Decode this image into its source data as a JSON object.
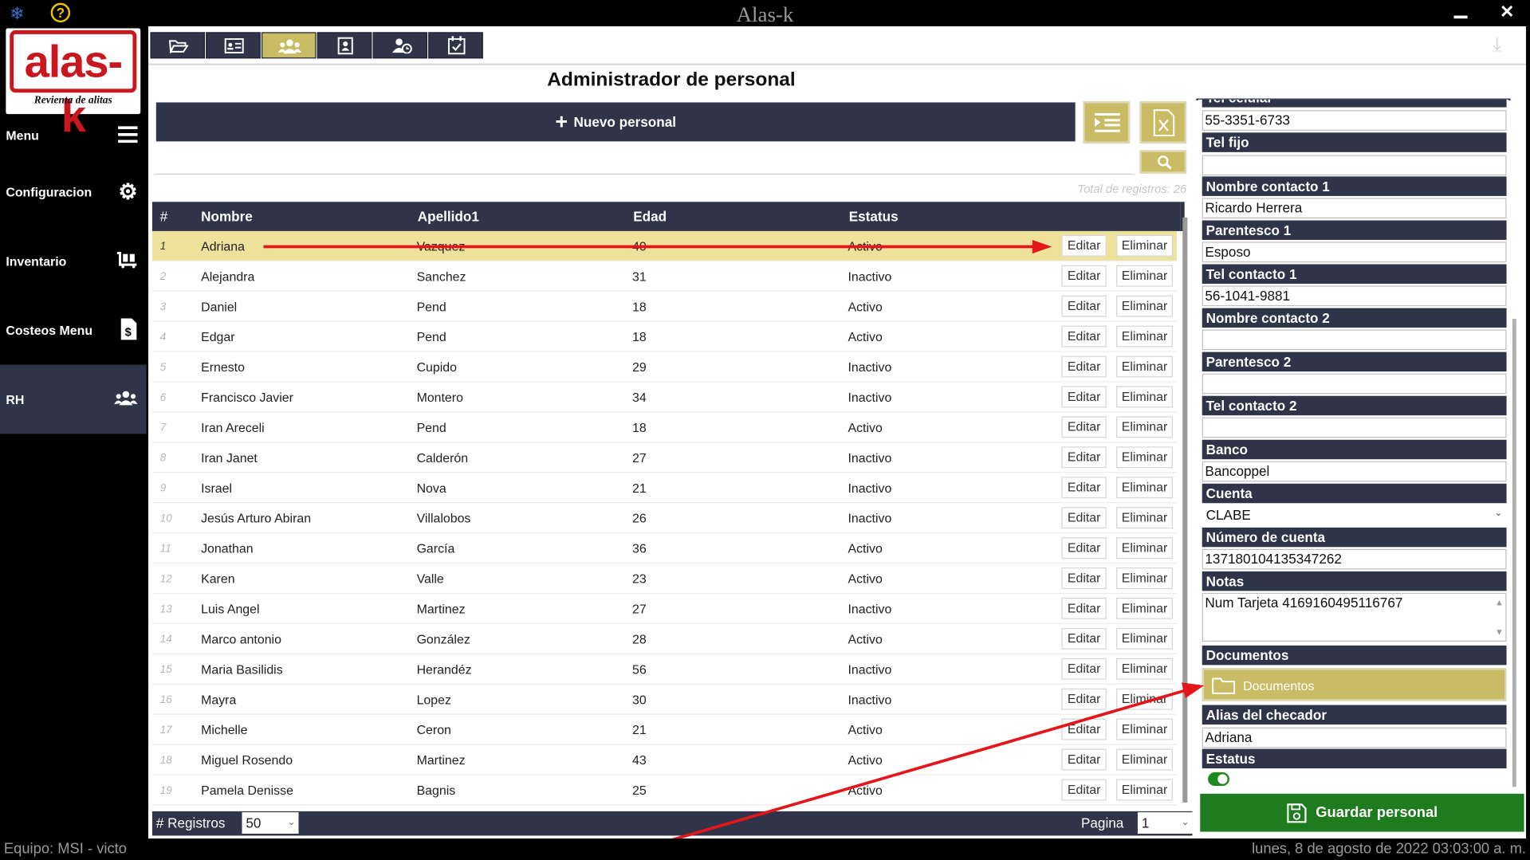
{
  "app": {
    "title": "Alas-k"
  },
  "sidebar": {
    "logo_text": "alas-k",
    "logo_tagline": "Revienta de alitas",
    "items": [
      {
        "label": "Menu",
        "icon": "hamburger-icon"
      },
      {
        "label": "Configuracion",
        "icon": "gear-icon"
      },
      {
        "label": "Inventario",
        "icon": "inventory-cart-icon"
      },
      {
        "label": "Costeos Menu",
        "icon": "invoice-dollar-icon"
      },
      {
        "label": "RH",
        "icon": "users-icon"
      }
    ]
  },
  "toolbar": {
    "tabs": [
      {
        "icon": "folder-open-icon"
      },
      {
        "icon": "id-card-icon"
      },
      {
        "icon": "users-icon"
      },
      {
        "icon": "contact-book-icon"
      },
      {
        "icon": "user-clock-icon"
      },
      {
        "icon": "calendar-check-icon"
      }
    ]
  },
  "main": {
    "title": "Administrador de personal",
    "new_button": "Nuevo personal",
    "search_placeholder": "",
    "total_label": "Total de registros:",
    "total_count": "26"
  },
  "table": {
    "headers": [
      "#",
      "Nombre",
      "Apellido1",
      "Edad",
      "Estatus"
    ],
    "edit_label": "Editar",
    "delete_label": "Eliminar",
    "rows": [
      {
        "n": "1",
        "nombre": "Adriana",
        "apellido": "Vazquez",
        "edad": "40",
        "estatus": "Activo"
      },
      {
        "n": "2",
        "nombre": "Alejandra",
        "apellido": "Sanchez",
        "edad": "31",
        "estatus": "Inactivo"
      },
      {
        "n": "3",
        "nombre": "Daniel",
        "apellido": "Pend",
        "edad": "18",
        "estatus": "Activo"
      },
      {
        "n": "4",
        "nombre": "Edgar",
        "apellido": "Pend",
        "edad": "18",
        "estatus": "Activo"
      },
      {
        "n": "5",
        "nombre": "Ernesto",
        "apellido": "Cupido",
        "edad": "29",
        "estatus": "Inactivo"
      },
      {
        "n": "6",
        "nombre": "Francisco Javier",
        "apellido": "Montero",
        "edad": "34",
        "estatus": "Inactivo"
      },
      {
        "n": "7",
        "nombre": "Iran Areceli",
        "apellido": "Pend",
        "edad": "18",
        "estatus": "Activo"
      },
      {
        "n": "8",
        "nombre": "Iran Janet",
        "apellido": "Calderón",
        "edad": "27",
        "estatus": "Inactivo"
      },
      {
        "n": "9",
        "nombre": "Israel",
        "apellido": "Nova",
        "edad": "21",
        "estatus": "Inactivo"
      },
      {
        "n": "10",
        "nombre": "Jesús Arturo Abiran",
        "apellido": "Villalobos",
        "edad": "26",
        "estatus": "Inactivo"
      },
      {
        "n": "11",
        "nombre": "Jonathan",
        "apellido": "García",
        "edad": "36",
        "estatus": "Activo"
      },
      {
        "n": "12",
        "nombre": "Karen",
        "apellido": "Valle",
        "edad": "23",
        "estatus": "Activo"
      },
      {
        "n": "13",
        "nombre": "Luis Angel",
        "apellido": "Martinez",
        "edad": "27",
        "estatus": "Inactivo"
      },
      {
        "n": "14",
        "nombre": "Marco antonio",
        "apellido": "González",
        "edad": "28",
        "estatus": "Activo"
      },
      {
        "n": "15",
        "nombre": "Maria Basilidis",
        "apellido": "Herandéz",
        "edad": "56",
        "estatus": "Inactivo"
      },
      {
        "n": "16",
        "nombre": "Mayra",
        "apellido": "Lopez",
        "edad": "30",
        "estatus": "Inactivo"
      },
      {
        "n": "17",
        "nombre": "Michelle",
        "apellido": "Ceron",
        "edad": "21",
        "estatus": "Activo"
      },
      {
        "n": "18",
        "nombre": "Miguel Rosendo",
        "apellido": "Martinez",
        "edad": "43",
        "estatus": "Activo"
      },
      {
        "n": "19",
        "nombre": "Pamela Denisse",
        "apellido": "Bagnis",
        "edad": "25",
        "estatus": "Activo"
      }
    ]
  },
  "footer": {
    "registros_label": "# Registros",
    "registros_value": "50",
    "pagina_label": "Pagina",
    "pagina_value": "1"
  },
  "form": {
    "tel_celular_label": "Tel celular",
    "tel_celular": "55-3351-6733",
    "tel_fijo_label": "Tel fijo",
    "tel_fijo": "",
    "contacto1_label": "Nombre contacto 1",
    "contacto1": "Ricardo Herrera",
    "parentesco1_label": "Parentesco 1",
    "parentesco1": "Esposo",
    "telcontacto1_label": "Tel contacto 1",
    "telcontacto1": "56-1041-9881",
    "contacto2_label": "Nombre contacto 2",
    "contacto2": "",
    "parentesco2_label": "Parentesco 2",
    "parentesco2": "",
    "telcontacto2_label": "Tel contacto 2",
    "telcontacto2": "",
    "banco_label": "Banco",
    "banco": "Bancoppel",
    "cuenta_label": "Cuenta",
    "cuenta": "CLABE",
    "numcuenta_label": "Número de cuenta",
    "numcuenta": "137180104135347262",
    "notas_label": "Notas",
    "notas": "Num Tarjeta 4169160495116767",
    "documentos_label": "Documentos",
    "documentos_button": "Documentos",
    "alias_label": "Alias del checador",
    "alias": "Adriana",
    "estatus_label": "Estatus",
    "estatus_on": true,
    "save_button": "Guardar personal"
  },
  "status": {
    "equipo": "Equipo: MSI - victo",
    "datetime": "lunes, 8 de agosto de 2022 03:03:00 a. m."
  },
  "colors": {
    "navy": "#2f3448",
    "gold": "#c9bc64",
    "selected_row": "#eee19a",
    "save_green": "#1e7b1e",
    "annotation_red": "#e5161b"
  }
}
